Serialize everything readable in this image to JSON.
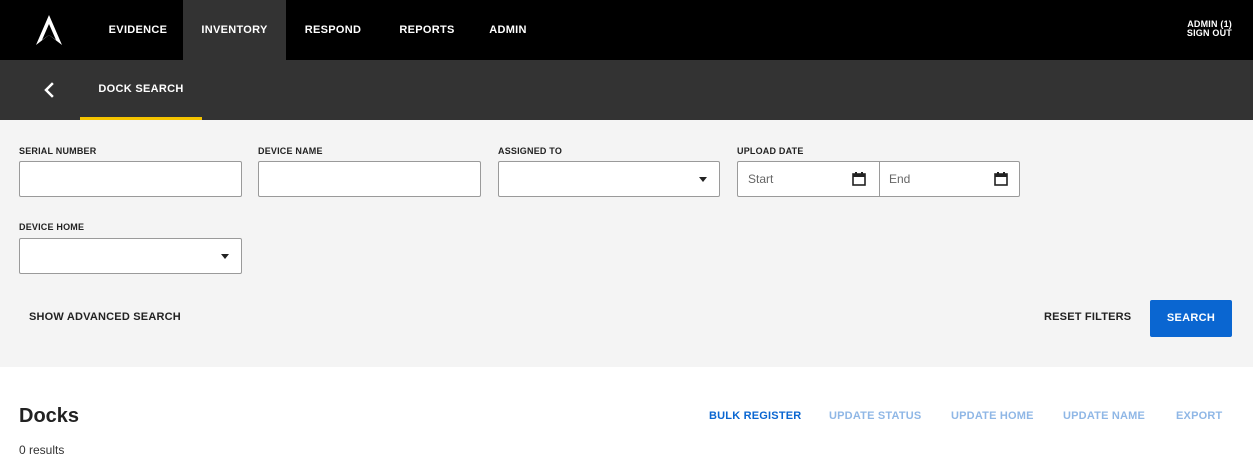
{
  "nav": {
    "items": [
      {
        "label": "EVIDENCE"
      },
      {
        "label": "INVENTORY"
      },
      {
        "label": "RESPOND"
      },
      {
        "label": "REPORTS"
      },
      {
        "label": "ADMIN"
      }
    ],
    "active": "INVENTORY",
    "user_label": "ADMIN (1)",
    "signout_label": "SIGN OUT"
  },
  "subnav": {
    "tab_label": "DOCK SEARCH",
    "accent_color": "#f5c400"
  },
  "filters": {
    "serial_number": {
      "label": "SERIAL NUMBER",
      "value": ""
    },
    "device_name": {
      "label": "DEVICE NAME",
      "value": ""
    },
    "assigned_to": {
      "label": "ASSIGNED TO",
      "value": ""
    },
    "upload_date": {
      "label": "UPLOAD DATE",
      "start_placeholder": "Start",
      "end_placeholder": "End"
    },
    "device_home": {
      "label": "DEVICE HOME",
      "value": ""
    },
    "show_advanced": "SHOW ADVANCED SEARCH",
    "reset": "RESET FILTERS",
    "search": "SEARCH"
  },
  "results": {
    "title": "Docks",
    "count_text": "0 results",
    "actions": [
      {
        "label": "BULK REGISTER",
        "enabled": true
      },
      {
        "label": "UPDATE STATUS",
        "enabled": false
      },
      {
        "label": "UPDATE HOME",
        "enabled": false
      },
      {
        "label": "UPDATE NAME",
        "enabled": false
      },
      {
        "label": "EXPORT",
        "enabled": false
      }
    ]
  },
  "colors": {
    "primary": "#0a66d1",
    "disabled_action": "#8fb7e6",
    "topbar": "#000000",
    "subbar": "#333333"
  },
  "icons": [
    "logo-icon",
    "chevron-left-icon",
    "chevron-down-icon",
    "calendar-icon"
  ]
}
